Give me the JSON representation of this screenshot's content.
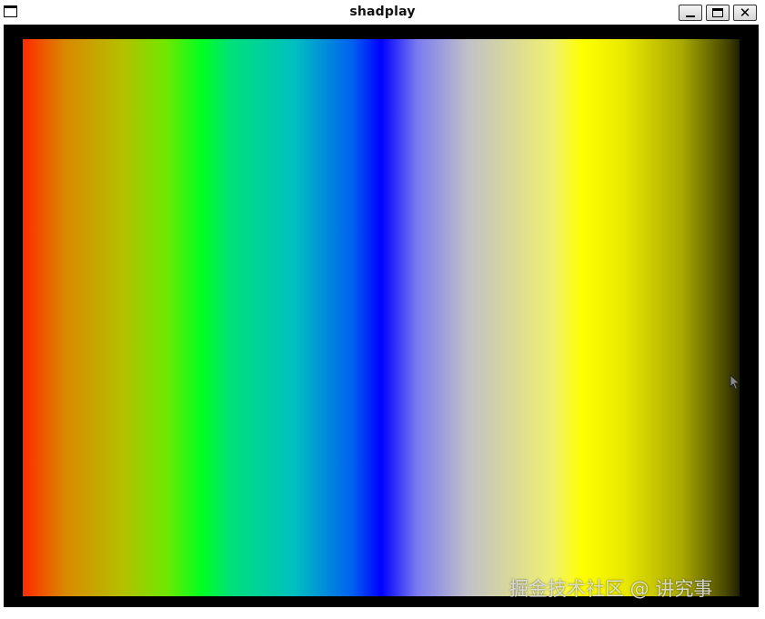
{
  "window": {
    "title": "shadplay",
    "icons": {
      "system_menu": "window-menu-icon",
      "minimize": "minimize-icon",
      "maximize": "maximize-icon",
      "close": "close-icon",
      "close_glyph": "✕"
    }
  },
  "canvas": {
    "colors": [
      "#ff2a00",
      "#b4c000",
      "#00ff20",
      "#00bfc0",
      "#0000ff",
      "#c0c0c8",
      "#ffff00",
      "#202000"
    ],
    "background": "#000000"
  },
  "cursor": {
    "icon": "mouse-pointer-icon"
  },
  "watermark": {
    "text": "掘金技术社区 @ 讲究事"
  }
}
